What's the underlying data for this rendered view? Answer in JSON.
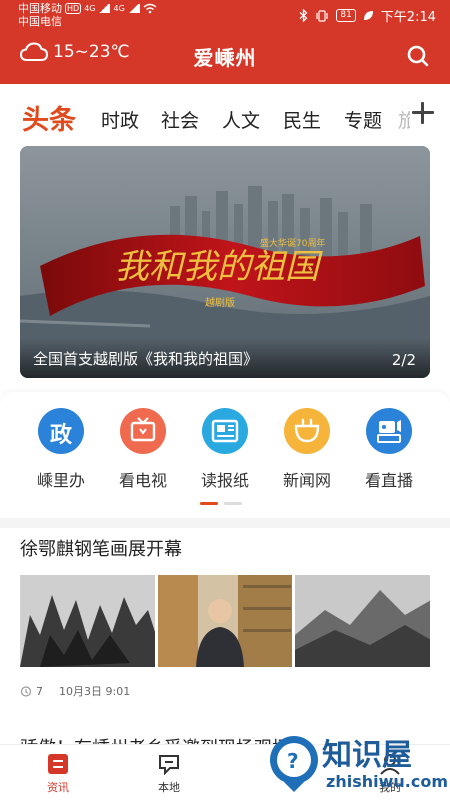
{
  "status_bar": {
    "carrier1": "中国移动",
    "carrier2": "中国电信",
    "hd": "HD",
    "net1": "4G",
    "net2": "4G",
    "battery": "81",
    "time": "下午2:14"
  },
  "header": {
    "weather": "15~23℃",
    "title": "爱嵊州",
    "icons": [
      "cloud-icon",
      "search-icon"
    ],
    "bg_color": "#d53728"
  },
  "tabs": {
    "items": [
      "头条",
      "时政",
      "社会",
      "人文",
      "民生",
      "专题"
    ],
    "active_index": 0,
    "overflow_partial": "旅",
    "accent_color": "#e04a1c"
  },
  "banner": {
    "title": "全国首支越剧版《我和我的祖国》",
    "page": "2/2",
    "art_text": "我和我的祖国",
    "art_subtitle": "越剧版",
    "art_top": "盛大华诞70周年"
  },
  "quick_links": [
    {
      "label": "嵊里办",
      "icon": "gov-icon",
      "color": "#2b82d9",
      "glyph": "政"
    },
    {
      "label": "看电视",
      "icon": "tv-icon",
      "color": "#ef6a4f"
    },
    {
      "label": "读报纸",
      "icon": "newspaper-icon",
      "color": "#2aa8e0"
    },
    {
      "label": "新闻网",
      "icon": "news-web-icon",
      "color": "#f6b43a"
    },
    {
      "label": "看直播",
      "icon": "live-icon",
      "color": "#2b82d9"
    }
  ],
  "carousel": {
    "active": 0,
    "count": 2
  },
  "article": {
    "title": "徐鄂麒钢笔画展开幕",
    "views": "7",
    "date": "10月3日 9:01"
  },
  "next_article": {
    "title": "骄傲！有嵊州老乡受邀到现场观场"
  },
  "bottom_nav": [
    {
      "label": "资讯",
      "icon": "news-icon",
      "active": true
    },
    {
      "label": "本地",
      "icon": "local-icon",
      "active": false
    },
    {
      "label": "我的",
      "icon": "profile-icon",
      "active": false
    }
  ],
  "watermark": {
    "text": "知识屋",
    "url": "zhishiwu.com"
  }
}
